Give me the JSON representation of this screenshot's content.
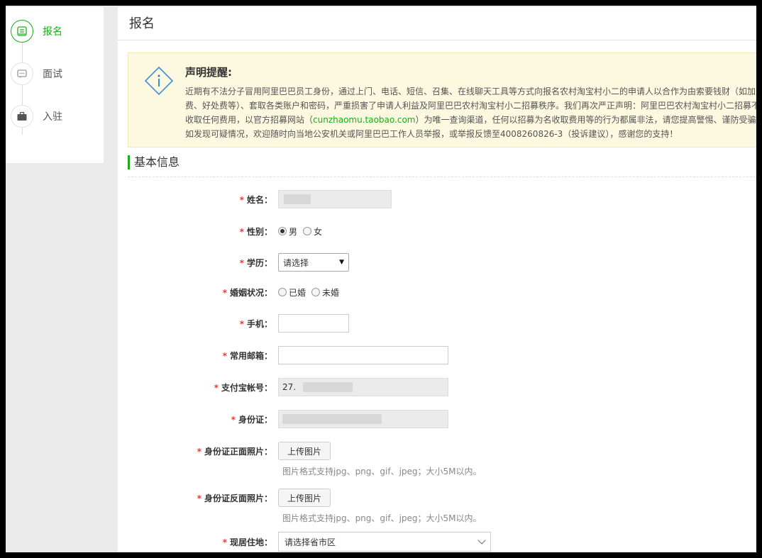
{
  "sidebar": {
    "steps": [
      {
        "label": "报名",
        "icon": "form-icon",
        "active": true
      },
      {
        "label": "面试",
        "icon": "chat-icon",
        "active": false
      },
      {
        "label": "入驻",
        "icon": "briefcase-icon",
        "active": false
      }
    ]
  },
  "main": {
    "title": "报名",
    "notice": {
      "title": "声明提醒:",
      "paragraph1_a": "近期有不法分子冒用阿里巴巴员工身份，通过上门、电话、短信、召集、在线聊天工具等方式向报名农村淘宝村小二的申请人以合作为由索要钱财（如加盟费、好处费等）、套取各类账户和密码，严重损害了申请人利益及阿里巴巴农村淘宝村小二招募秩序。我们再次严正声明：阿里巴巴农村淘宝村小二招募不收取任何费用，以官方招募网站（",
      "link": "cunzhaomu.taobao.com",
      "paragraph1_b": "）为唯一查询渠道，任何以招募为名收取费用等的行为都属非法，请您提高警惕、谨防受骗。",
      "paragraph2": "如发现可疑情况，欢迎随时向当地公安机关或阿里巴巴工作人员举报，或举报反馈至4008260826-3（投诉建议），感谢您的支持！"
    },
    "section_title": "基本信息",
    "form": {
      "name_label": "姓名：",
      "gender_label": "性别：",
      "gender_male": "男",
      "gender_female": "女",
      "education_label": "学历：",
      "education_value": "请选择",
      "marital_label": "婚姻状况：",
      "marital_married": "已婚",
      "marital_unmarried": "未婚",
      "phone_label": "手机：",
      "email_label": "常用邮箱：",
      "alipay_label": "支付宝帐号：",
      "alipay_value": "27.",
      "idcard_label": "身份证：",
      "idfront_label": "身份证正面照片：",
      "idback_label": "身份证反面照片：",
      "upload_label": "上传图片",
      "upload_hint": "图片格式支持jpg、png、gif、jpeg；大小5M以内。",
      "residence_label": "现居住地：",
      "residence_value": "请选择省市区"
    }
  },
  "colors": {
    "accent": "#1aad19",
    "required": "#e4393c",
    "notice_bg": "#fdf8e0"
  }
}
